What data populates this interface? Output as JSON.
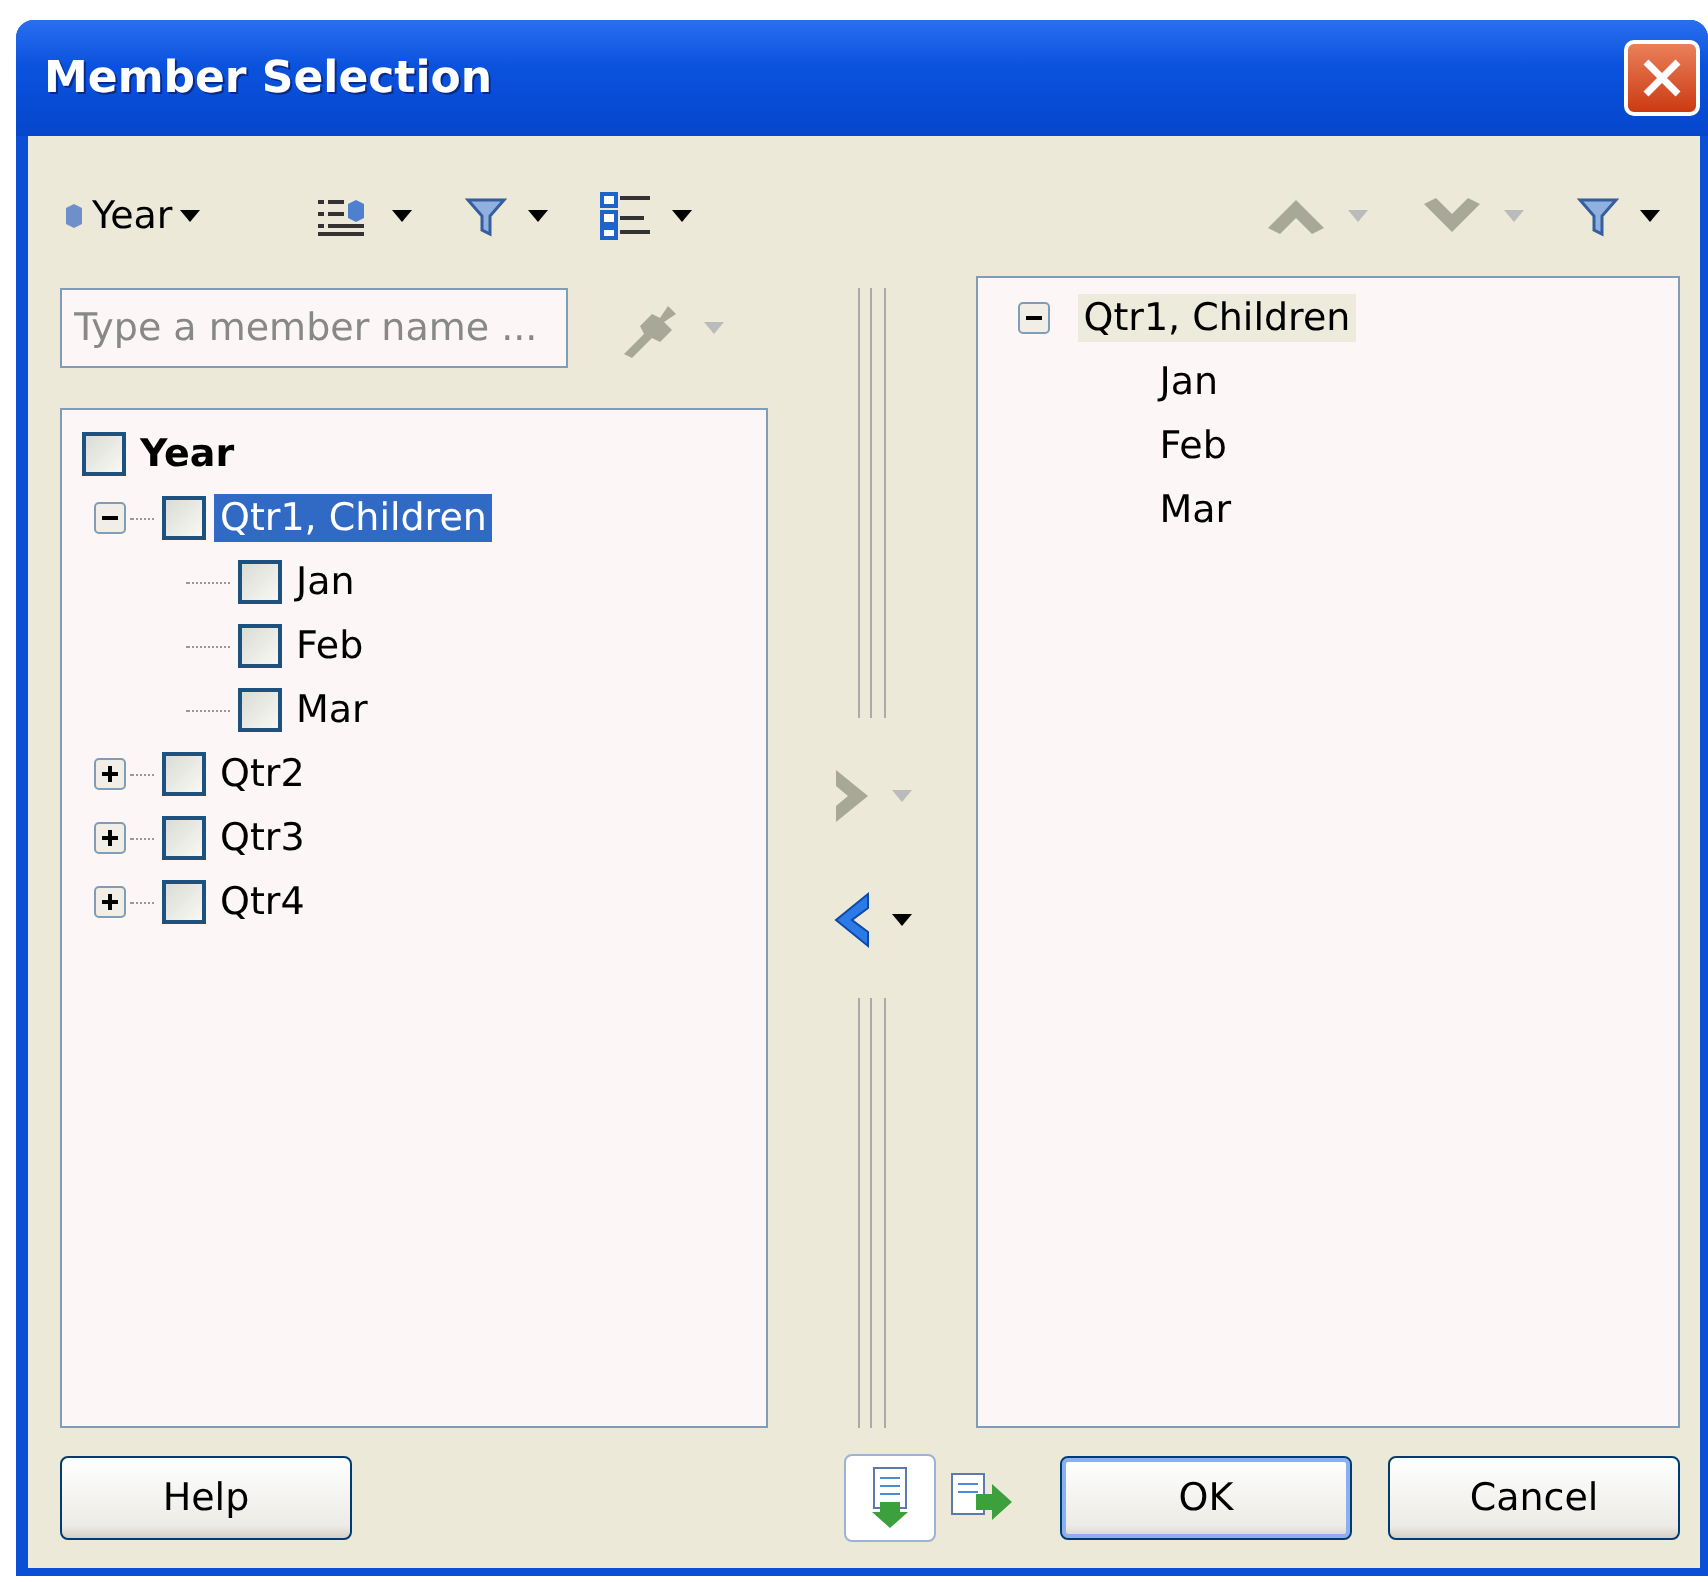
{
  "window": {
    "title": "Member Selection"
  },
  "dimension_menu": {
    "label": "Year"
  },
  "left_toolbar": [
    {
      "kind": "layout",
      "disabled": false
    },
    {
      "kind": "filter",
      "disabled": false
    },
    {
      "kind": "hierarchy",
      "disabled": false
    }
  ],
  "search": {
    "placeholder": "Type a member name ..."
  },
  "search_tool": {
    "kind": "key",
    "disabled": true
  },
  "right_toolbar": [
    {
      "kind": "up",
      "disabled": true
    },
    {
      "kind": "down",
      "disabled": true
    },
    {
      "kind": "filter",
      "disabled": false
    }
  ],
  "member_tree": [
    {
      "label": "Year",
      "checked": false,
      "selected": false,
      "children": [
        {
          "label": "Qtr1, Children",
          "checked": false,
          "selected": true,
          "expanded": true,
          "children": [
            {
              "label": "Jan",
              "checked": false,
              "selected": false
            },
            {
              "label": "Feb",
              "checked": false,
              "selected": false
            },
            {
              "label": "Mar",
              "checked": false,
              "selected": false
            }
          ]
        },
        {
          "label": "Qtr2",
          "checked": false,
          "selected": false,
          "expanded": false
        },
        {
          "label": "Qtr3",
          "checked": false,
          "selected": false,
          "expanded": false
        },
        {
          "label": "Qtr4",
          "checked": false,
          "selected": false,
          "expanded": false
        }
      ]
    }
  ],
  "move_buttons": [
    {
      "kind": "add",
      "disabled": true
    },
    {
      "kind": "remove",
      "disabled": false
    }
  ],
  "selection": [
    {
      "label": "Qtr1, Children",
      "selected": true,
      "expanded": true,
      "children": [
        {
          "label": "Jan",
          "selected": false
        },
        {
          "label": "Feb",
          "selected": false
        },
        {
          "label": "Mar",
          "selected": false
        }
      ]
    }
  ],
  "buttons": [
    {
      "label": "Help",
      "default": false
    },
    {
      "label": "OK",
      "default": true
    },
    {
      "label": "Cancel",
      "default": false
    }
  ]
}
